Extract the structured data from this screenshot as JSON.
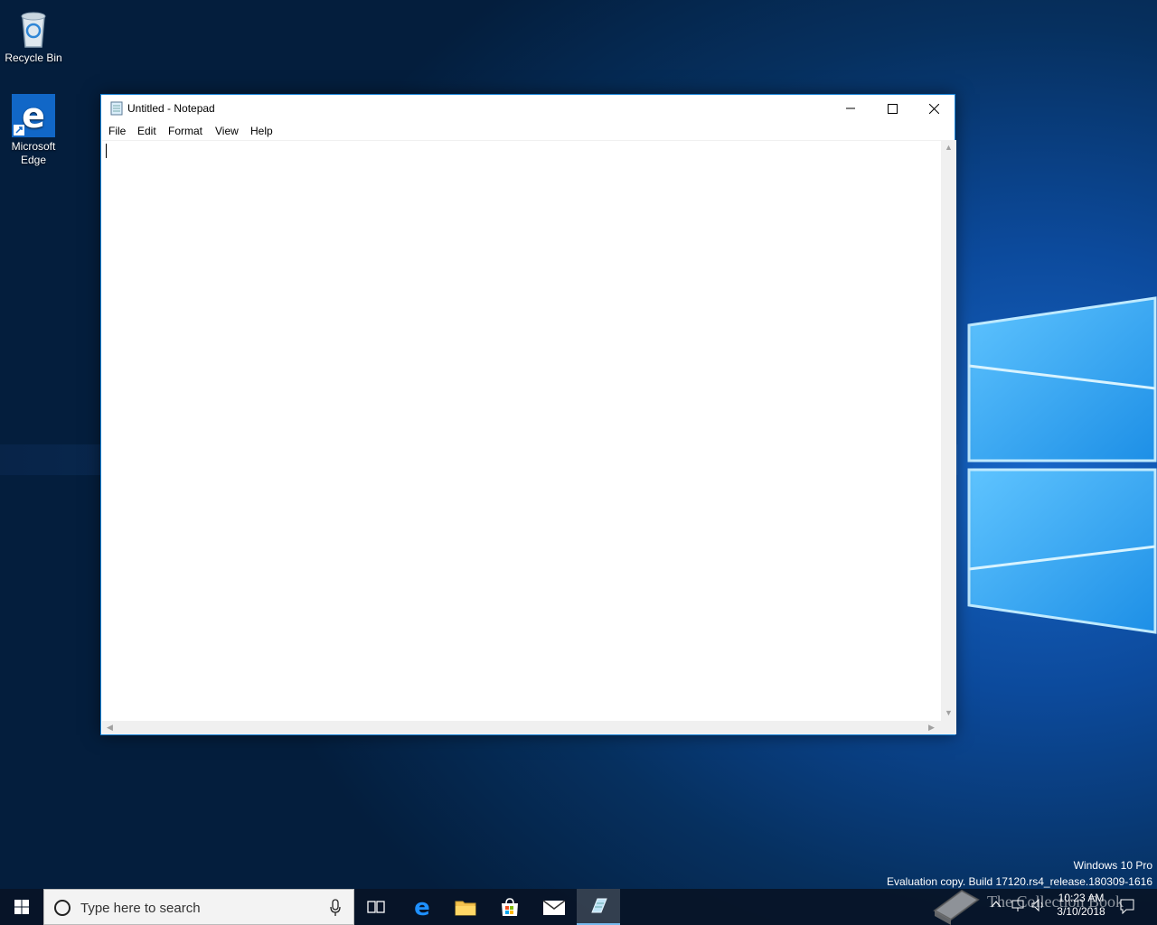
{
  "desktop": {
    "icons": [
      {
        "label": "Recycle Bin",
        "icon": "recycle-bin-icon"
      },
      {
        "label": "Microsoft Edge",
        "icon": "edge-icon"
      }
    ],
    "watermark": {
      "edition": "Windows 10 Pro",
      "build": "Evaluation copy. Build 17120.rs4_release.180309-1616"
    }
  },
  "notepad": {
    "title": "Untitled - Notepad",
    "menu": [
      "File",
      "Edit",
      "Format",
      "View",
      "Help"
    ],
    "content": ""
  },
  "taskbar": {
    "search_placeholder": "Type here to search",
    "apps": [
      "task-view-icon",
      "edge-icon",
      "file-explorer-icon",
      "store-icon",
      "mail-icon",
      "notepad-icon"
    ],
    "active_app": "notepad-icon",
    "clock": {
      "time": "10:23 AM",
      "date": "3/10/2018"
    },
    "overlay_text": "The Collection Book"
  },
  "colors": {
    "accent": "#1883d7",
    "taskbar": "#08142a",
    "desktop": "#0c4a9c"
  }
}
